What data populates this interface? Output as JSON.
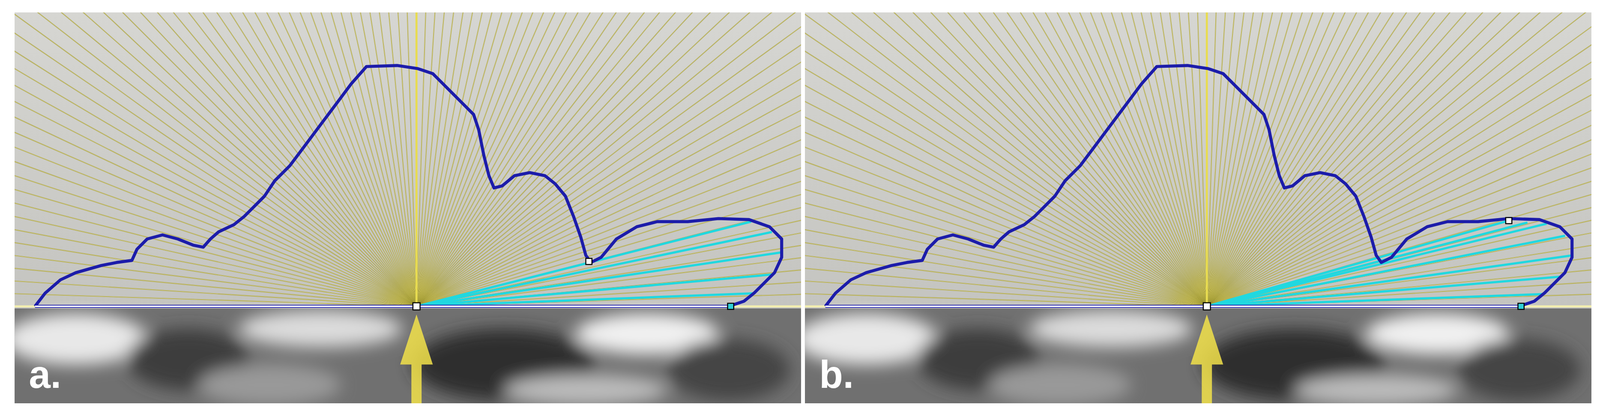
{
  "panels": [
    {
      "label": "a.",
      "highlighted_rays": 6
    },
    {
      "label": "b.",
      "highlighted_rays": 8
    }
  ]
}
